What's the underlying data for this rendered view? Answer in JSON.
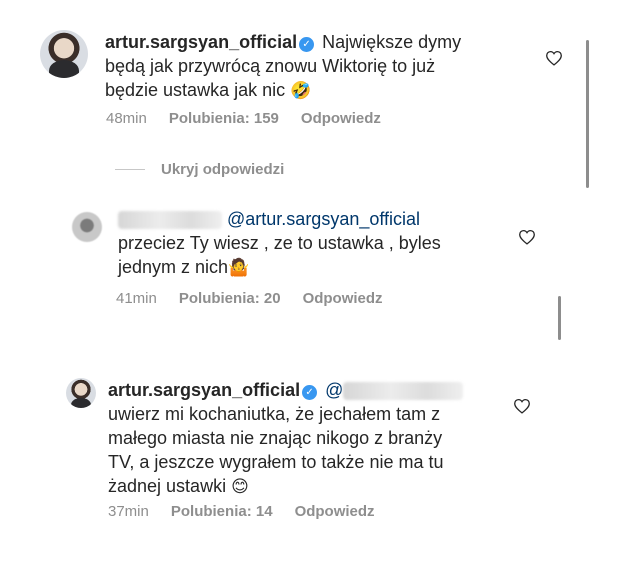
{
  "comments": [
    {
      "username": "artur.sargsyan_official",
      "verified_icon": "verified-badge-icon",
      "text_line1": "Największe dymy",
      "text_line2": "będą jak przywrócą znowu Wiktorię to już",
      "text_line3": "będzie ustawka jak nic",
      "emoji": "🤣",
      "time": "48min",
      "likes": "Polubienia: 159",
      "reply": "Odpowiedz"
    },
    {
      "mention": "@artur.sargsyan_official",
      "text_line1": "przeciez Ty wiesz , ze to ustawka , byles",
      "text_line2": "jednym z nich",
      "emoji": "🤷",
      "time": "41min",
      "likes": "Polubienia: 20",
      "reply": "Odpowiedz"
    },
    {
      "username": "artur.sargsyan_official",
      "verified_icon": "verified-badge-icon",
      "mention_partial": "@",
      "text_line1": "uwierz mi kochaniutka, że jechałem tam z",
      "text_line2": "małego miasta nie znając nikogo z branży",
      "text_line3": "TV, a jeszcze wygrałem to także nie ma tu",
      "text_line4": "żadnej ustawki",
      "emoji": "😊",
      "time": "37min",
      "likes": "Polubienia: 14",
      "reply": "Odpowiedz"
    }
  ],
  "hide_replies_label": "Ukryj odpowiedzi",
  "colors": {
    "text": "#262626",
    "meta": "#8e8e8e",
    "mention": "#00376b",
    "verified": "#3897f0"
  }
}
